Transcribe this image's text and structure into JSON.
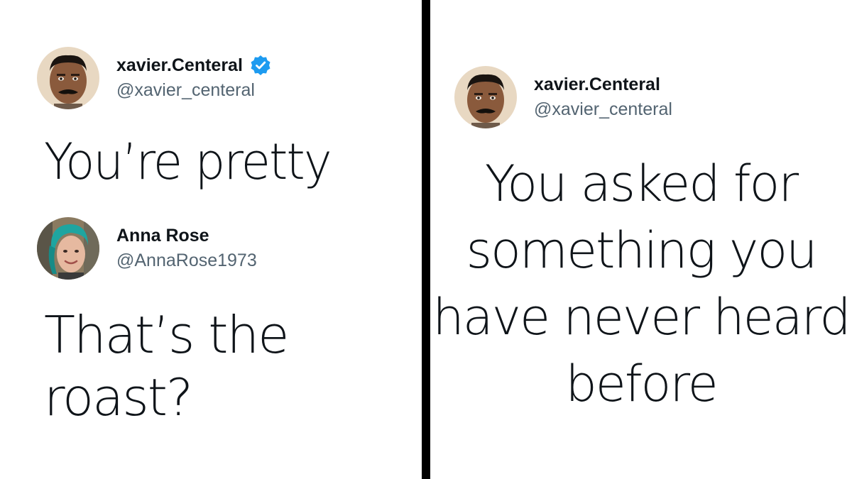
{
  "left_panel": {
    "tweet1": {
      "display_name": "xavier.Centeral",
      "handle": "@xavier_centeral",
      "verified": true,
      "avatar_icon": "man-with-mustache-avatar",
      "text": "You’re pretty"
    },
    "tweet2": {
      "display_name": "Anna Rose",
      "handle": "@AnnaRose1973",
      "verified": false,
      "avatar_icon": "woman-with-blue-hair-avatar",
      "text": "That’s the roast?"
    }
  },
  "right_panel": {
    "tweet": {
      "display_name": "xavier.Centeral",
      "handle": "@xavier_centeral",
      "avatar_icon": "man-with-mustache-avatar",
      "text": "You asked for something you have never heard before"
    }
  },
  "colors": {
    "text_primary": "#0f1419",
    "text_secondary": "#536471",
    "verified_blue": "#1d9bf0",
    "divider": "#000000",
    "background": "#ffffff"
  }
}
